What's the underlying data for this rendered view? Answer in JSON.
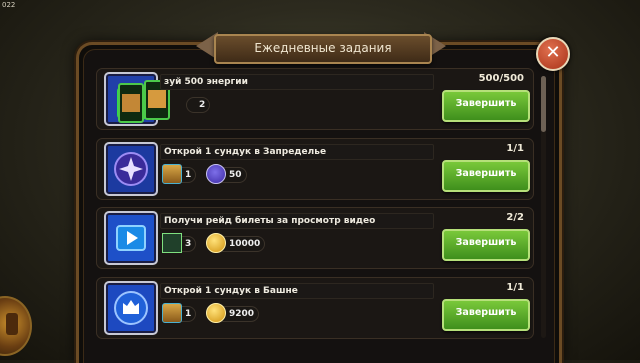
{
  "corner_label": "022",
  "header": {
    "title": "Ежедневные задания",
    "close_glyph": "✕"
  },
  "tasks": [
    {
      "title": "зуй 500 энергии",
      "progress": "500/500",
      "button": "Завершить",
      "icon": "treasure-chests-icon",
      "rewards": [
        {
          "icon": "chest-reward-icon",
          "amount": "2"
        }
      ]
    },
    {
      "title": "Открой 1 сундук в Запределье",
      "progress": "1/1",
      "button": "Завершить",
      "icon": "beyond-portal-icon",
      "rewards": [
        {
          "icon": "chest-reward-icon",
          "amount": "1"
        },
        {
          "icon": "energy-orb-icon",
          "amount": "50"
        }
      ]
    },
    {
      "title": "Получи рейд билеты за просмотр видео",
      "progress": "2/2",
      "button": "Завершить",
      "icon": "video-play-icon",
      "rewards": [
        {
          "icon": "raid-ticket-icon",
          "amount": "3"
        },
        {
          "icon": "gold-coin-icon",
          "amount": "10000"
        }
      ]
    },
    {
      "title": "Открой 1 сундук в Башне",
      "progress": "1/1",
      "button": "Завершить",
      "icon": "tower-icon",
      "rewards": [
        {
          "icon": "chest-reward-icon",
          "amount": "1"
        },
        {
          "icon": "gold-coin-icon",
          "amount": "9200"
        }
      ]
    }
  ],
  "colors": {
    "complete_button": "#4f9f24",
    "panel_border": "#6b4b24",
    "title_banner": "#5a4126"
  }
}
